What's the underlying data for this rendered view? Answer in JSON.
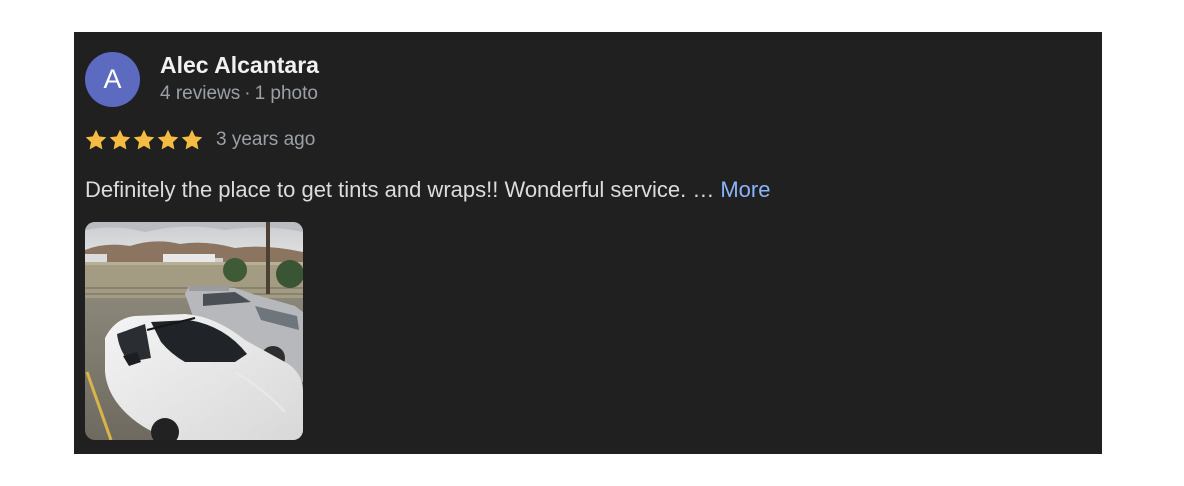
{
  "reviewer": {
    "avatar_letter": "A",
    "avatar_color": "#5c6bc0",
    "name": "Alec Alcantara",
    "reviews": "4 reviews",
    "separator": "·",
    "photos": "1 photo"
  },
  "rating": {
    "stars": 5,
    "max_stars": 5,
    "star_color": "#f6bb42",
    "time_ago": "3 years ago"
  },
  "review": {
    "text": "Definitely the place to get tints and wraps!! Wonderful service. …",
    "more_label": "More",
    "more_color": "#8ab4f8"
  },
  "photo": {
    "subject": "white sedan with tinted windows parked in lot"
  }
}
